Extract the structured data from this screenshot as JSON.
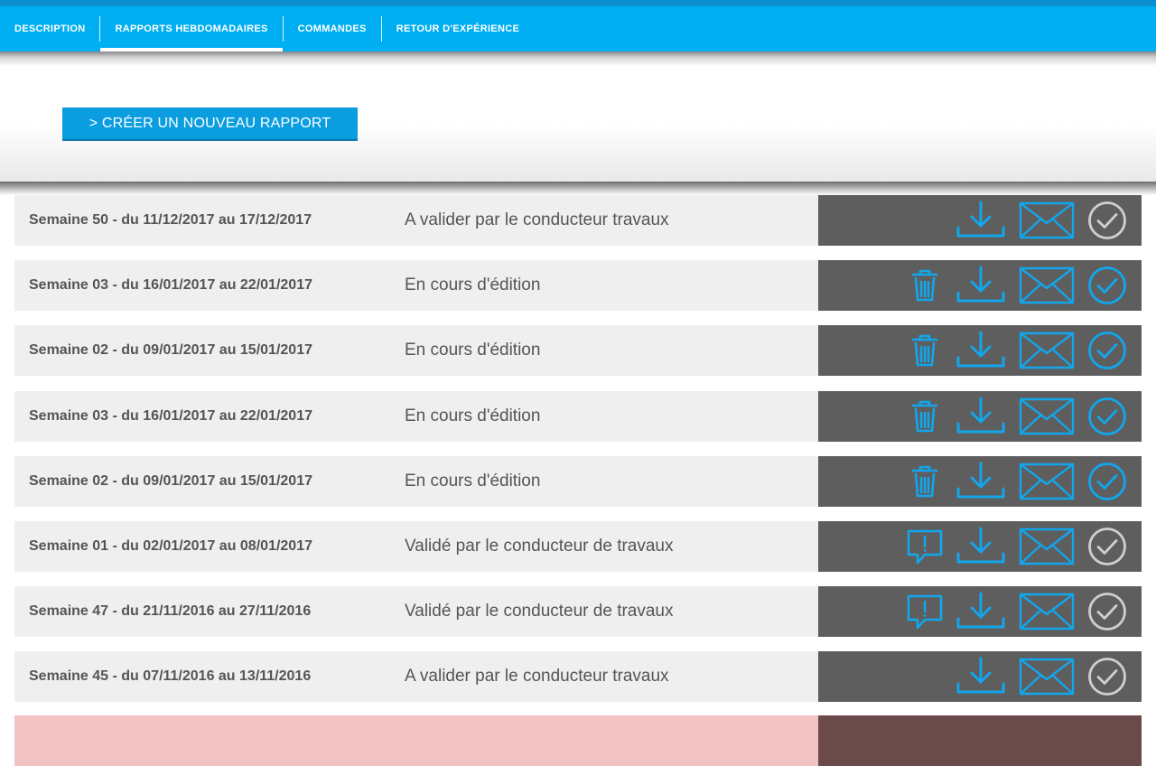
{
  "tabs": [
    {
      "label": "DESCRIPTION",
      "active": false
    },
    {
      "label": "RAPPORTS HEBDOMADAIRES",
      "active": true
    },
    {
      "label": "COMMANDES",
      "active": false
    },
    {
      "label": "RETOUR D'EXPÉRIENCE",
      "active": false
    }
  ],
  "toolbar": {
    "create_label": "> CRÉER UN NOUVEAU RAPPORT"
  },
  "colors": {
    "accent": "#00aef2",
    "icon_blue": "#12a6ec",
    "icon_grey": "#cfcfcf",
    "row_bg": "#efefef",
    "actions_bg": "#5e5e5e"
  },
  "reports": [
    {
      "week": "Semaine 50 - du 11/12/2017 au 17/12/2017",
      "status": "A valider par le conducteur travaux",
      "left_icon": null,
      "check_active": false
    },
    {
      "week": "Semaine 03 - du 16/01/2017 au 22/01/2017",
      "status": "En cours d'édition",
      "left_icon": "trash-icon",
      "check_active": true
    },
    {
      "week": "Semaine 02 - du 09/01/2017 au 15/01/2017",
      "status": "En cours d'édition",
      "left_icon": "trash-icon",
      "check_active": true
    },
    {
      "week": "Semaine 03 - du 16/01/2017 au 22/01/2017",
      "status": "En cours d'édition",
      "left_icon": "trash-icon",
      "check_active": true
    },
    {
      "week": "Semaine 02 - du 09/01/2017 au 15/01/2017",
      "status": "En cours d'édition",
      "left_icon": "trash-icon",
      "check_active": true
    },
    {
      "week": "Semaine 01 - du 02/01/2017 au 08/01/2017",
      "status": "Validé par le conducteur de travaux",
      "left_icon": "comment-alert-icon",
      "check_active": false
    },
    {
      "week": "Semaine 47 - du 21/11/2016 au 27/11/2016",
      "status": "Validé par le conducteur de travaux",
      "left_icon": "comment-alert-icon",
      "check_active": false
    },
    {
      "week": "Semaine 45 - du 07/11/2016 au 13/11/2016",
      "status": "A valider par le conducteur travaux",
      "left_icon": null,
      "check_active": false
    }
  ]
}
